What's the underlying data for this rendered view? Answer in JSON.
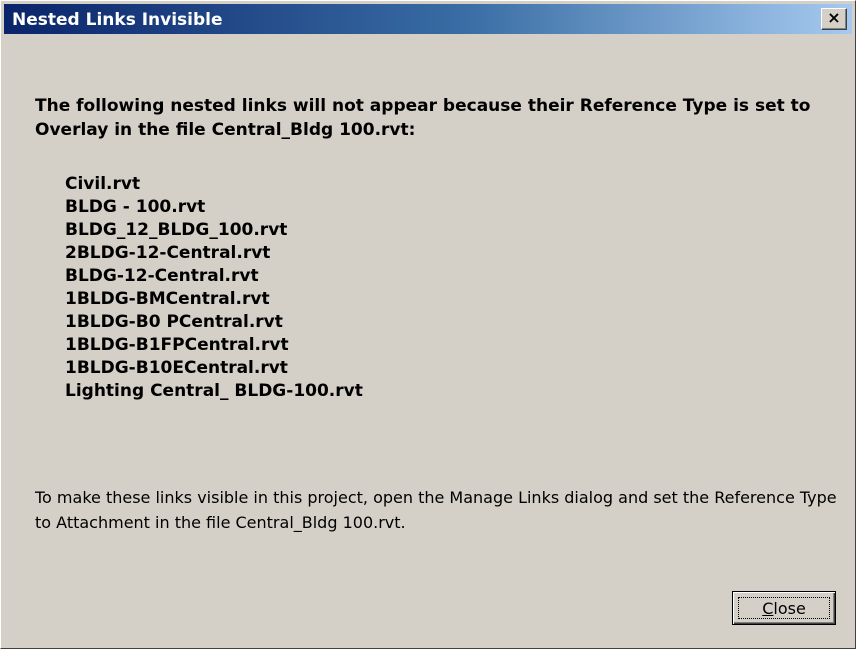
{
  "window": {
    "title": "Nested Links Invisible",
    "close_glyph": "×"
  },
  "message": {
    "heading": "The following nested links will not appear because their Reference Type is set to Overlay in the file Central_Bldg 100.rvt:",
    "files": [
      "Civil.rvt",
      "BLDG - 100.rvt",
      "BLDG_12_BLDG_100.rvt",
      "2BLDG-12-Central.rvt",
      "BLDG-12-Central.rvt",
      "1BLDG-BMCentral.rvt",
      "1BLDG-B0 PCentral.rvt",
      "1BLDG-B1FPCentral.rvt",
      "1BLDG-B10ECentral.rvt",
      "Lighting Central_ BLDG-100.rvt"
    ],
    "footer": "To make these links visible in this project, open the Manage Links dialog and set the Reference Type to Attachment in the file Central_Bldg 100.rvt."
  },
  "buttons": {
    "close_mnemonic": "C",
    "close_rest": "lose"
  },
  "colors": {
    "dialog_background": "#d4d0c8",
    "titlebar_start": "#0a246a",
    "titlebar_end": "#a6caf0",
    "title_text": "#ffffff"
  },
  "icons": {
    "title_close": "close-icon"
  }
}
